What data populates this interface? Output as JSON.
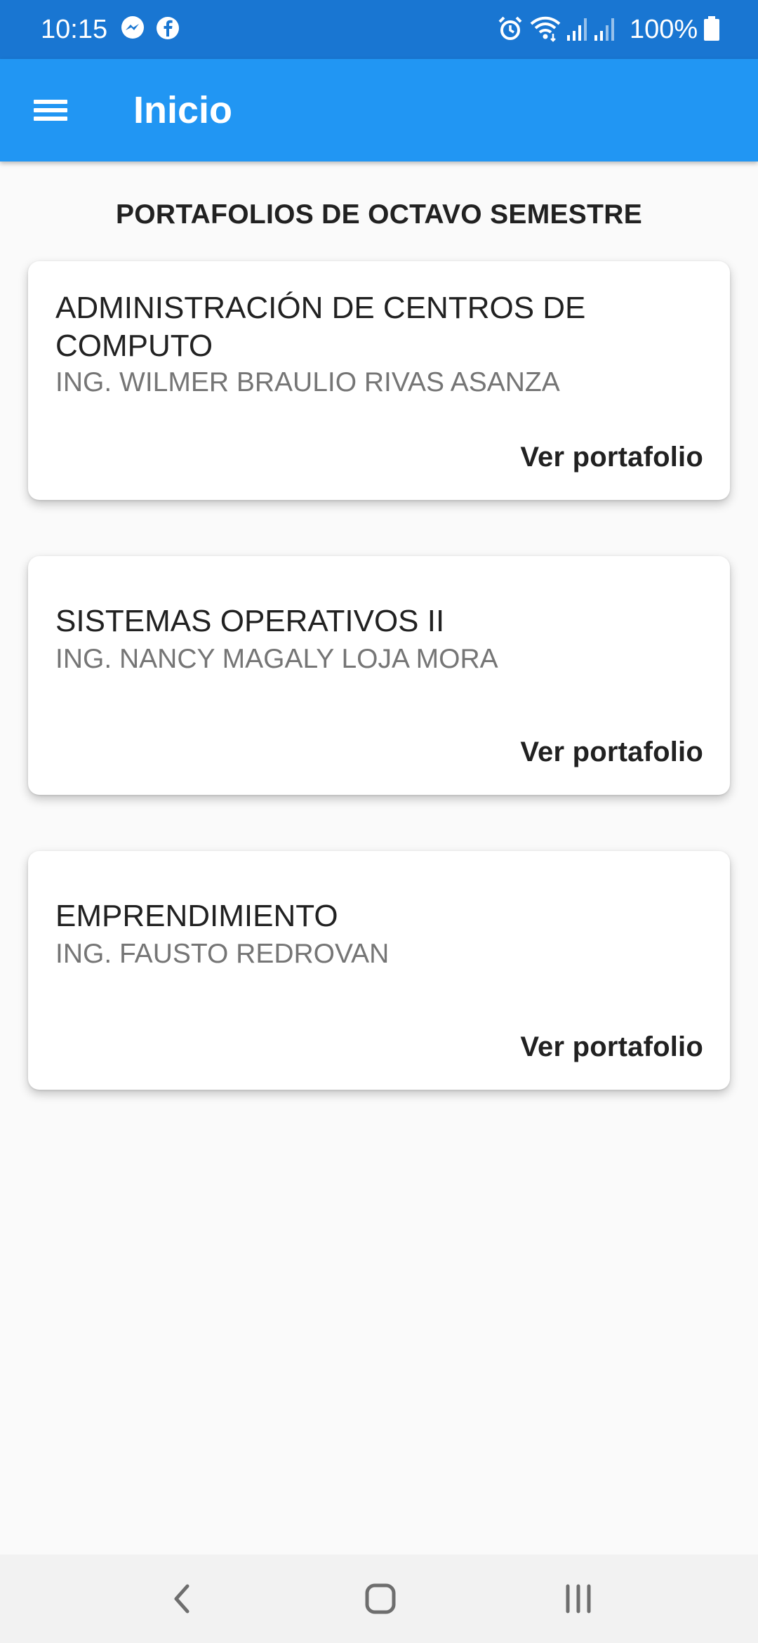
{
  "status_bar": {
    "time": "10:15",
    "battery": "100%",
    "left_icons": [
      "messenger-icon",
      "facebook-icon"
    ],
    "right_icons": [
      "alarm-icon",
      "wifi-icon",
      "signal-icon",
      "signal-icon",
      "battery-icon"
    ]
  },
  "app_bar": {
    "title": "Inicio",
    "menu_icon": "hamburger-menu-icon",
    "color": "#2196f3"
  },
  "section": {
    "heading": "PORTAFOLIOS DE OCTAVO SEMESTRE"
  },
  "cards": [
    {
      "course_line1": "ADMINISTRACIÓN DE CENTROS DE",
      "course_line2": "COMPUTO",
      "teacher": "ING. WILMER BRAULIO RIVAS ASANZA",
      "action": "Ver portafolio"
    },
    {
      "course_line1": "SISTEMAS OPERATIVOS II",
      "teacher": "ING. NANCY MAGALY LOJA MORA",
      "action": "Ver portafolio"
    },
    {
      "course_line1": "EMPRENDIMIENTO",
      "teacher": "ING. FAUSTO REDROVAN",
      "action": "Ver portafolio"
    }
  ],
  "nav_bar": {
    "buttons": [
      "back-icon",
      "home-icon",
      "recents-icon"
    ]
  }
}
